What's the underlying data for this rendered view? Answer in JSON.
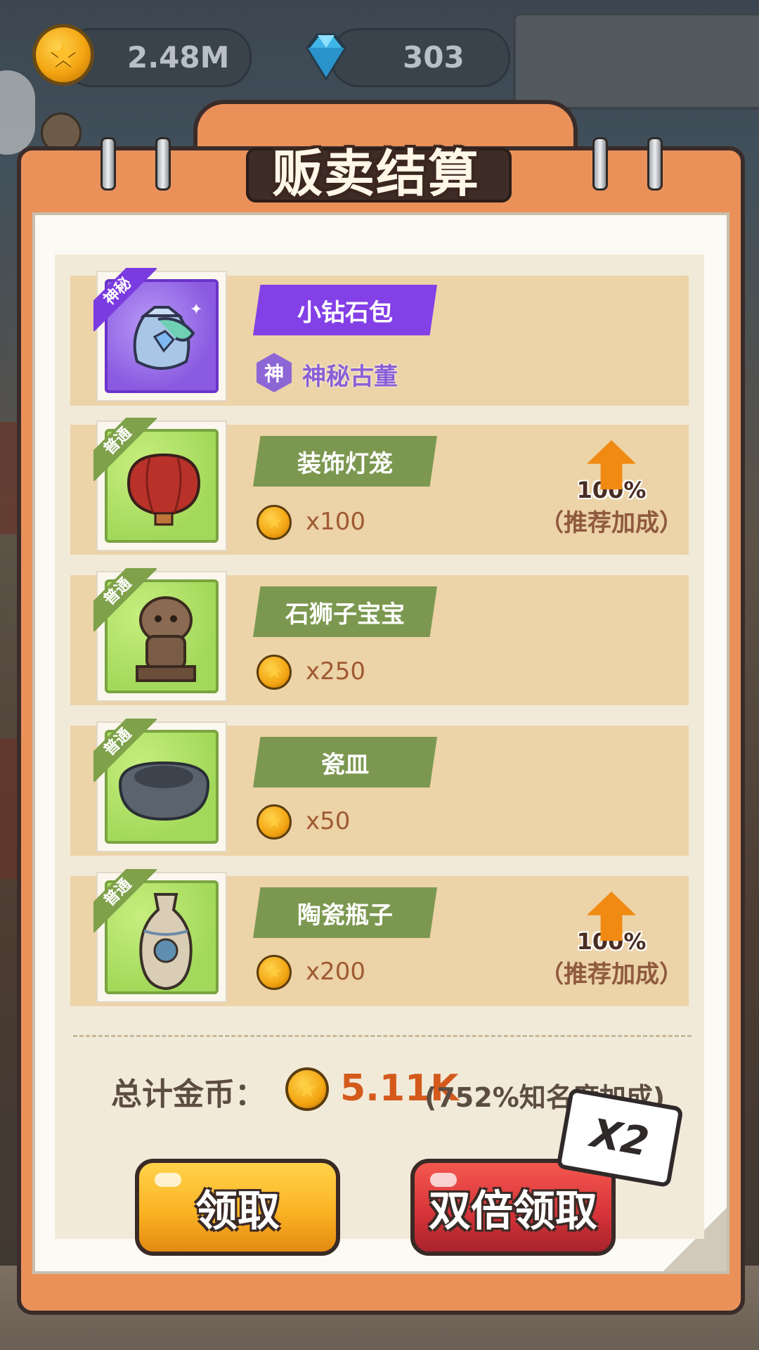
{
  "top_bar": {
    "coins": "2.48M",
    "gems": "303",
    "coin_icon": "gold-coin-icon",
    "gem_icon": "blue-gem-icon"
  },
  "modal": {
    "title": "贩卖结算",
    "items": [
      {
        "tag": "神秘",
        "name": "小钻石包",
        "subtitle_badge": "神",
        "subtitle": "神秘古董",
        "quantity": "",
        "bonus_pct": "",
        "bonus_note": ""
      },
      {
        "tag": "普通",
        "name": "装饰灯笼",
        "quantity": "x100",
        "bonus_pct": "100%",
        "bonus_note": "（推荐加成）"
      },
      {
        "tag": "普通",
        "name": "石狮子宝宝",
        "quantity": "x250",
        "bonus_pct": "",
        "bonus_note": ""
      },
      {
        "tag": "普通",
        "name": "瓷皿",
        "quantity": "x50",
        "bonus_pct": "",
        "bonus_note": ""
      },
      {
        "tag": "普通",
        "name": "陶瓷瓶子",
        "quantity": "x200",
        "bonus_pct": "100%",
        "bonus_note": "（推荐加成）"
      }
    ],
    "total_label": "总计金币：",
    "total_value": "5.11K",
    "total_note": "(752%知名度加成)",
    "x2_label": "X2",
    "claim_button": "领取",
    "double_button": "双倍领取"
  },
  "colors": {
    "modal_orange": "#ea915a",
    "row_bg": "#ecd3a8",
    "green_banner": "#7c9850",
    "purple_banner": "#8340e6",
    "claim_yellow": "#fbb324",
    "double_red": "#d8353a",
    "total_orange": "#d45a1c"
  }
}
